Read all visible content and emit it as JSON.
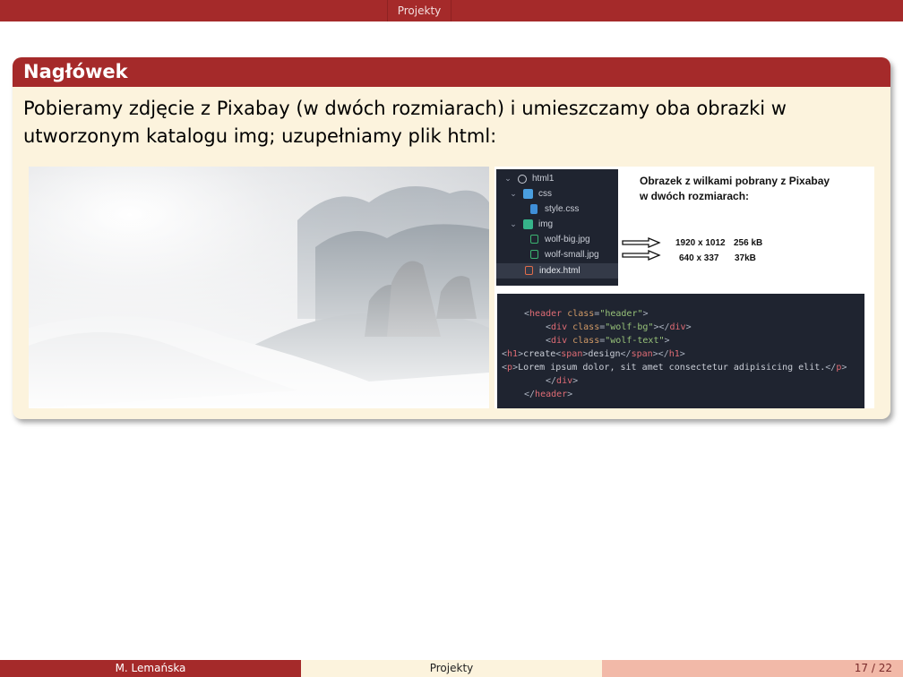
{
  "header": {
    "section_tab": "Projekty"
  },
  "block": {
    "title": "Nagłówek",
    "body_text": "Pobieramy zdjęcie z Pixabay (w dwóch rozmiarach) i umieszczamy oba obrazki w utworzonym katalogu img; uzupełniamy plik html:"
  },
  "file_tree": [
    {
      "label": "html1",
      "icon": "circle-icon",
      "expanded": true
    },
    {
      "label": "css",
      "icon": "folder-icon",
      "expanded": true
    },
    {
      "label": "style.css",
      "icon": "css-file-icon"
    },
    {
      "label": "img",
      "icon": "folder-icon",
      "expanded": true
    },
    {
      "label": "wolf-big.jpg",
      "icon": "image-file-icon"
    },
    {
      "label": "wolf-small.jpg",
      "icon": "image-file-icon"
    },
    {
      "label": "index.html",
      "icon": "html-file-icon",
      "selected": true
    }
  ],
  "note": {
    "title_line1": "Obrazek z wilkami pobrany z Pixabay",
    "title_line2": "w dwóch rozmiarach:",
    "big_dims": "1920 x 1012",
    "big_size": "256 kB",
    "small_dims": "640 x 337",
    "small_size": "37kB"
  },
  "code": {
    "line1": {
      "tag": "header",
      "attr": "class",
      "val": "\"header\""
    },
    "line2": {
      "tag": "div",
      "attr": "class",
      "val": "\"wolf-bg\""
    },
    "line3": {
      "tag": "div",
      "attr": "class",
      "val": "\"wolf-text\""
    },
    "line4": {
      "tag": "h1",
      "text1": "create",
      "inner_tag": "span",
      "text2": "design"
    },
    "line5": {
      "tag": "p",
      "text": "Lorem ipsum dolor, sit amet consectetur adipisicing elit."
    },
    "line6": {
      "tag": "div"
    },
    "line7": {
      "tag": "header"
    }
  },
  "footer": {
    "author": "M. Lemańska",
    "title": "Projekty",
    "page": "17 / 22"
  },
  "colors": {
    "accent": "#a52a2a",
    "block_bg": "#fcf3dd",
    "editor_bg": "#1f2430"
  }
}
